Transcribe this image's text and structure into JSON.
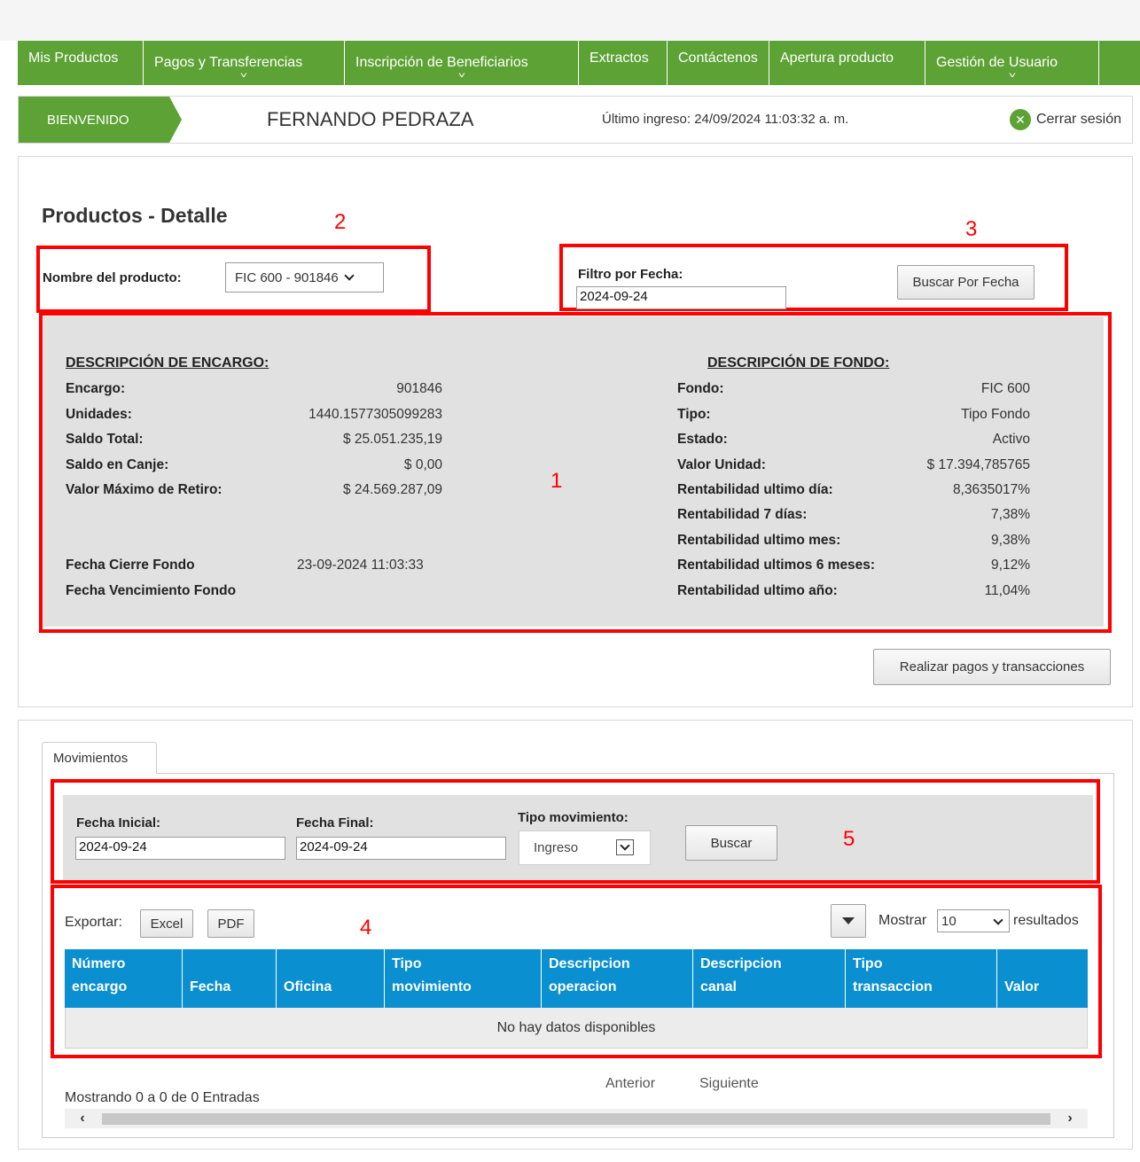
{
  "nav": {
    "items": [
      {
        "label": "Mis Productos",
        "dropdown": false
      },
      {
        "label": "Pagos y Transferencias",
        "dropdown": true
      },
      {
        "label": "Inscripción de Beneficiarios",
        "dropdown": true
      },
      {
        "label": "Extractos",
        "dropdown": false
      },
      {
        "label": "Contáctenos",
        "dropdown": false
      },
      {
        "label": "Apertura producto",
        "dropdown": false
      },
      {
        "label": "Gestión de Usuario",
        "dropdown": true
      }
    ]
  },
  "welcome": {
    "badge": "BIENVENIDO",
    "user_name": "FERNANDO PEDRAZA",
    "last_login": "Último ingreso: 24/09/2024 11:03:32 a. m.",
    "logout_label": "Cerrar sesión"
  },
  "page": {
    "title": "Productos - Detalle",
    "product_label": "Nombre del producto:",
    "product_value": "FIC 600 - 901846",
    "date_filter_label": "Filtro por Fecha:",
    "date_filter_value": "2024-09-24",
    "search_by_date_button": "Buscar Por Fecha",
    "pay_button": "Realizar pagos y transacciones"
  },
  "annotations": {
    "n1": "1",
    "n2": "2",
    "n3": "3",
    "n4": "4",
    "n5": "5"
  },
  "encargo": {
    "title": "DESCRIPCIÓN DE ENCARGO:",
    "rows": [
      {
        "label": "Encargo:",
        "value": "901846"
      },
      {
        "label": "Unidades:",
        "value": "1440.1577305099283"
      },
      {
        "label": "Saldo Total:",
        "value": "$ 25.051.235,19"
      },
      {
        "label": "Saldo en Canje:",
        "value": "$ 0,00"
      },
      {
        "label": "Valor Máximo de Retiro:",
        "value": "$ 24.569.287,09"
      }
    ],
    "cierre_label": "Fecha Cierre Fondo",
    "cierre_value": "23-09-2024 11:03:33",
    "vencimiento_label": "Fecha Vencimiento Fondo"
  },
  "fondo": {
    "title": "DESCRIPCIÓN DE FONDO:",
    "rows": [
      {
        "label": "Fondo:",
        "value": "FIC 600"
      },
      {
        "label": "Tipo:",
        "value": "Tipo Fondo"
      },
      {
        "label": "Estado:",
        "value": "Activo"
      },
      {
        "label": "Valor Unidad:",
        "value": "$ 17.394,785765"
      },
      {
        "label": "Rentabilidad ultimo día:",
        "value": "8,3635017%"
      },
      {
        "label": "Rentabilidad 7 días:",
        "value": "7,38%"
      },
      {
        "label": "Rentabilidad ultimo mes:",
        "value": "9,38%"
      },
      {
        "label": "Rentabilidad ultimos 6 meses:",
        "value": "9,12%"
      },
      {
        "label": "Rentabilidad ultimo año:",
        "value": "11,04%"
      }
    ]
  },
  "movimientos": {
    "tab_label": "Movimientos",
    "fecha_inicial_label": "Fecha Inicial:",
    "fecha_inicial_value": "2024-09-24",
    "fecha_final_label": "Fecha Final:",
    "fecha_final_value": "2024-09-24",
    "tipo_label": "Tipo movimiento:",
    "tipo_value": "Ingreso",
    "buscar_button": "Buscar",
    "export_label": "Exportar:",
    "excel_button": "Excel",
    "pdf_button": "PDF",
    "show_label": "Mostrar",
    "show_value": "10",
    "results_label": "resultados",
    "columns": [
      [
        "Número",
        "encargo"
      ],
      [
        "",
        "Fecha"
      ],
      [
        "",
        "Oficina"
      ],
      [
        "Tipo",
        "movimiento"
      ],
      [
        "Descripcion",
        "operacion"
      ],
      [
        "Descripcion",
        "canal"
      ],
      [
        "Tipo",
        "transaccion"
      ],
      [
        "",
        "Valor"
      ]
    ],
    "empty_text": "No hay datos disponibles",
    "showing_text": "Mostrando 0 a 0 de 0 Entradas",
    "prev_label": "Anterior",
    "next_label": "Siguiente"
  }
}
